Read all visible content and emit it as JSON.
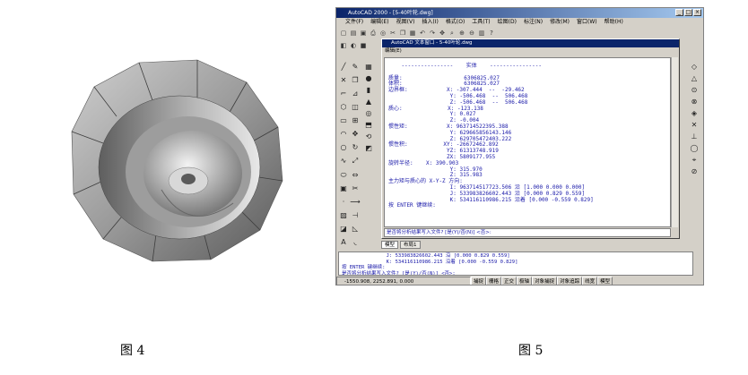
{
  "captions": {
    "fig4": "图 4",
    "fig5": "图 5"
  },
  "acad": {
    "title": "AutoCAD 2000 - [5-40叶轮.dwg]",
    "menu": [
      "文件(F)",
      "编辑(E)",
      "视图(V)",
      "插入(I)",
      "格式(O)",
      "工具(T)",
      "绘图(D)",
      "标注(N)",
      "修改(M)",
      "窗口(W)",
      "帮助(H)"
    ],
    "text_window": {
      "title": "AutoCAD 文本窗口 - 5-40叶轮.dwg",
      "menu": "编辑(E)",
      "body": "    ----------------    实体    ----------------\n\n质量:                   6306825.027\n体积:                   6306825.027\n边界框:            X: -307.444  --  -29.462\n                   Y: -506.468  --  506.468\n                   Z: -506.468  --  506.468\n质心:              X: -123.138\n                   Y: 0.027\n                   Z: -0.004\n惯性矩:            X: 963714522395.388\n                   Y: 629665856143.146\n                   Z: 629705472403.222\n惯性积:           XY: -26672462.892\n                  YZ: 61313748.919\n                  ZX: 5809177.955\n旋转半径:    X: 390.903\n                   Y: 315.970\n                   Z: 315.983\n主力矩与质心的 X-Y-Z 方向:\n                   I: 963714517723.506 沿 [1.000 0.000 0.000]\n                   J: 533983826602.443 沿 [0.000 0.829 0.559]\n                   K: 534116110986.215 沿着 [0.000 -0.559 0.829]\n按 ENTER 键继续:",
      "prompt": "是否将分析结果写入文件? [是(Y)/否(N)] <否>:"
    },
    "tabs": [
      "模型",
      "布局1"
    ],
    "command_lines": "               J: 533983826602.443 沿 [0.000 0.829 0.559]\n               K: 534116110986.215 沿着 [0.000 -0.559 0.829]\n按 ENTER 键继续:\n是否将分析结果写入文件? [是(Y)/否(N)] <否>:",
    "coordinates": "-1550.908, 2252.891, 0.000",
    "status_buttons": [
      "捕捉",
      "栅格",
      "正交",
      "极轴",
      "对象捕捉",
      "对象追踪",
      "线宽",
      "模型"
    ]
  }
}
